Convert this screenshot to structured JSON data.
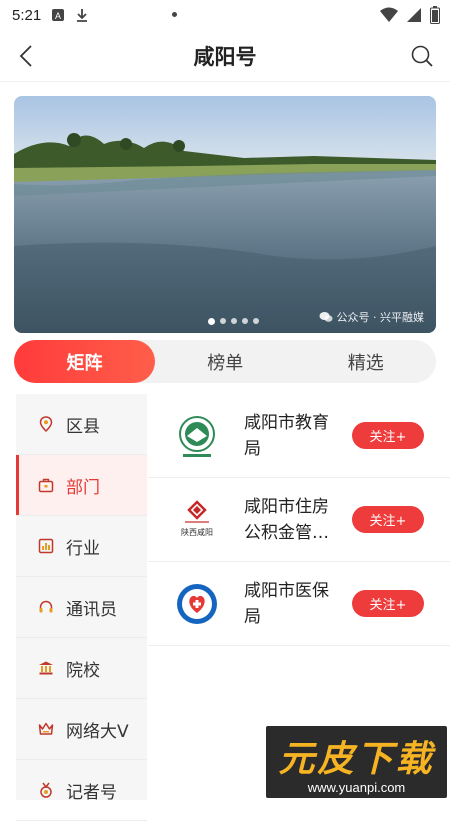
{
  "status_bar": {
    "time": "5:21"
  },
  "header": {
    "title": "咸阳号"
  },
  "banner": {
    "caption": "公众号 · 兴平融媒",
    "dots_count": 5,
    "active_dot": 0
  },
  "tabs": [
    {
      "label": "矩阵",
      "active": true
    },
    {
      "label": "榜单",
      "active": false
    },
    {
      "label": "精选",
      "active": false
    }
  ],
  "sidebar": {
    "items": [
      {
        "label": "区县",
        "icon": "location-pin-icon",
        "active": false
      },
      {
        "label": "部门",
        "icon": "briefcase-icon",
        "active": true
      },
      {
        "label": "行业",
        "icon": "bar-chart-icon",
        "active": false
      },
      {
        "label": "通讯员",
        "icon": "headset-icon",
        "active": false
      },
      {
        "label": "院校",
        "icon": "institution-icon",
        "active": false
      },
      {
        "label": "网络大V",
        "icon": "crown-icon",
        "active": false
      },
      {
        "label": "记者号",
        "icon": "medal-icon",
        "active": false
      }
    ]
  },
  "departments": [
    {
      "name": "咸阳市教育局",
      "follow_label": "关注+"
    },
    {
      "name": "咸阳市住房公积金管…",
      "follow_label": "关注+",
      "logo_text": "陕西咸阳"
    },
    {
      "name": "咸阳市医保局",
      "follow_label": "关注+"
    }
  ],
  "watermark": {
    "title": "元皮下载",
    "url": "www.yuanpi.com"
  },
  "colors": {
    "accent": "#ee3b3b",
    "tab_gradient_start": "#ff3b3b",
    "active_side_bg": "#fff0f0",
    "watermark_bg": "#2b2b2b",
    "watermark_text": "#f6b423"
  }
}
